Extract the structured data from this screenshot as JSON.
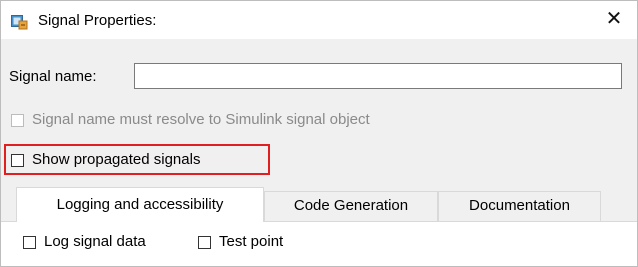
{
  "window": {
    "title": "Signal Properties:",
    "close_glyph": "✕",
    "app_icon": "simulink-block-icon"
  },
  "signal_name": {
    "label": "Signal name:",
    "value": "",
    "placeholder": ""
  },
  "checkboxes": {
    "resolve": {
      "label": "Signal name must resolve to Simulink signal object",
      "checked": false,
      "enabled": false
    },
    "show_propagated": {
      "label": "Show propagated signals",
      "checked": false,
      "enabled": true,
      "highlighted": true
    },
    "log_signal_data": {
      "label": "Log signal data",
      "checked": false
    },
    "test_point": {
      "label": "Test point",
      "checked": false
    }
  },
  "tabs": [
    {
      "label": "Logging and accessibility",
      "active": true
    },
    {
      "label": "Code Generation",
      "active": false
    },
    {
      "label": "Documentation",
      "active": false
    }
  ],
  "colors": {
    "highlight_border": "#e02020",
    "dialog_bg": "#f0f0f0",
    "disabled_text": "#8a8a8a"
  }
}
